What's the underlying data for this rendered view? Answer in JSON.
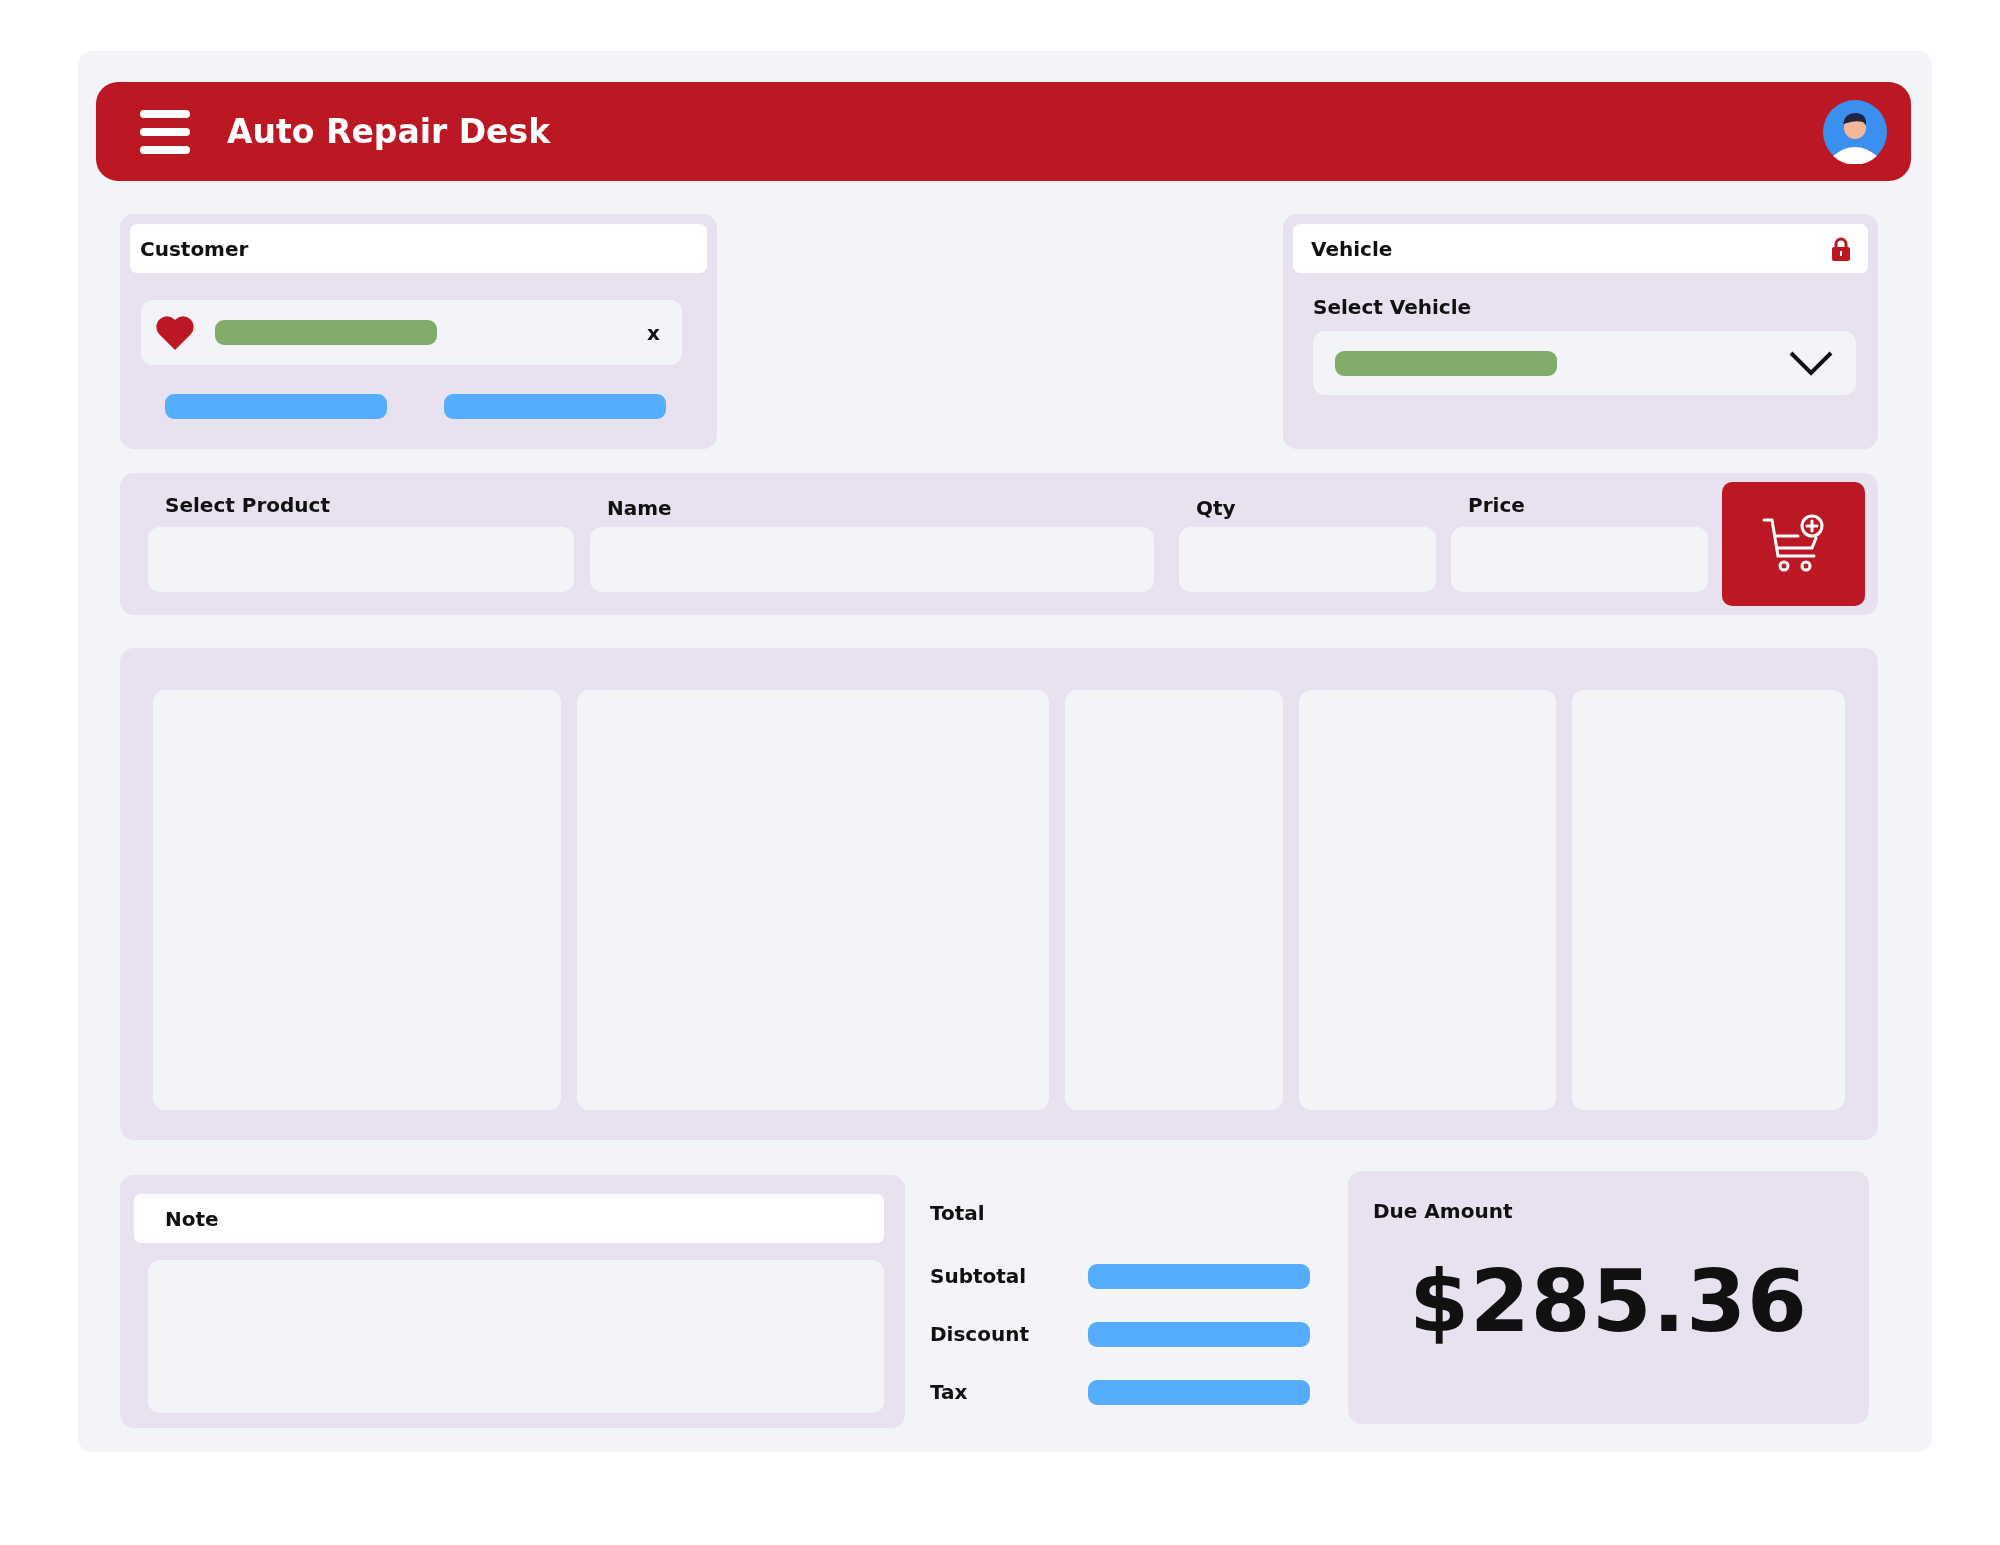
{
  "header": {
    "title": "Auto Repair Desk"
  },
  "customer": {
    "label": "Customer",
    "clear": "x"
  },
  "vehicle": {
    "label": "Vehicle",
    "select_label": "Select Vehicle"
  },
  "product_form": {
    "fields": [
      {
        "label": "Select Product"
      },
      {
        "label": "Name"
      },
      {
        "label": "Qty"
      },
      {
        "label": "Price"
      }
    ]
  },
  "note": {
    "label": "Note"
  },
  "totals": {
    "heading": "Total",
    "rows": [
      {
        "label": "Subtotal"
      },
      {
        "label": "Discount"
      },
      {
        "label": "Tax"
      }
    ]
  },
  "due": {
    "label": "Due Amount",
    "amount": "$285.36"
  }
}
